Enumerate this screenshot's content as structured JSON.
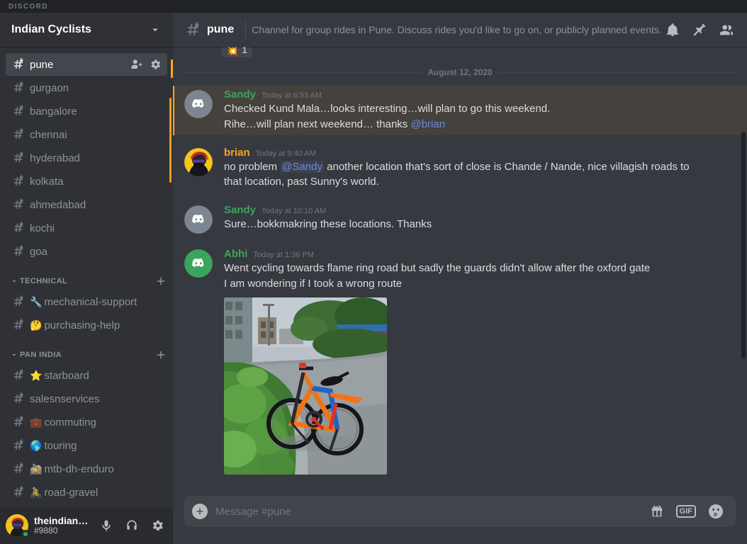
{
  "titlebar": {
    "wordmark": "DISCORD"
  },
  "sidebar": {
    "server_name": "Indian Cyclists",
    "chevron_icon": "chevron-down-icon",
    "channels": [
      {
        "name": "pune",
        "emoji": "",
        "active": true,
        "locked": true,
        "actions": [
          "add-member-icon",
          "gear-icon"
        ]
      },
      {
        "name": "gurgaon",
        "emoji": "",
        "active": false,
        "locked": true
      },
      {
        "name": "bangalore",
        "emoji": "",
        "active": false,
        "locked": true
      },
      {
        "name": "chennai",
        "emoji": "",
        "active": false,
        "locked": true
      },
      {
        "name": "hyderabad",
        "emoji": "",
        "active": false,
        "locked": true
      },
      {
        "name": "kolkata",
        "emoji": "",
        "active": false,
        "locked": true
      },
      {
        "name": "ahmedabad",
        "emoji": "",
        "active": false,
        "locked": true
      },
      {
        "name": "kochi",
        "emoji": "",
        "active": false,
        "locked": true
      },
      {
        "name": "goa",
        "emoji": "",
        "active": false,
        "locked": true
      }
    ],
    "categories": [
      {
        "name": "TECHNICAL",
        "add_icon": "plus-icon",
        "channels": [
          {
            "name": "mechanical-support",
            "emoji": "🔧",
            "locked": true
          },
          {
            "name": "purchasing-help",
            "emoji": "🤔",
            "locked": true
          }
        ]
      },
      {
        "name": "PAN INDIA",
        "add_icon": "plus-icon",
        "channels": [
          {
            "name": "starboard",
            "emoji": "⭐",
            "locked": true
          },
          {
            "name": "salesnservices",
            "emoji": "",
            "locked": true
          },
          {
            "name": "commuting",
            "emoji": "💼",
            "locked": true
          },
          {
            "name": "touring",
            "emoji": "🌎",
            "locked": true
          },
          {
            "name": "mtb-dh-enduro",
            "emoji": "🚵",
            "locked": true
          },
          {
            "name": "road-gravel",
            "emoji": "🚴",
            "locked": true
          }
        ]
      }
    ],
    "user_panel": {
      "username": "theindiancy...",
      "discriminator": "#9880",
      "status": "online",
      "buttons": [
        {
          "name": "microphone-icon",
          "label": "Mute"
        },
        {
          "name": "headphones-icon",
          "label": "Deafen"
        },
        {
          "name": "gear-icon",
          "label": "User Settings"
        }
      ]
    },
    "colors": {
      "accent_orange": "#faa61a",
      "background": "#2f3136"
    }
  },
  "header": {
    "hash_icon": "hash-lock-icon",
    "channel_name": "pune",
    "topic": "Channel for group rides in Pune. Discuss rides you'd like to go on, or publicly planned events.",
    "icons": [
      {
        "name": "bell-icon",
        "label": "Notification Settings"
      },
      {
        "name": "pin-icon",
        "label": "Pinned Messages"
      },
      {
        "name": "members-icon",
        "label": "Member List"
      }
    ]
  },
  "messages": {
    "top_reaction": {
      "emoji": "💥",
      "count": "1"
    },
    "date_divider": "August 12, 2020",
    "items": [
      {
        "author": "Sandy",
        "author_color": "#3ba55d",
        "timestamp": "Today at 6:53 AM",
        "avatar": "discord-default-grey",
        "mention_highlight": true,
        "lines": [
          [
            {
              "t": "Checked Kund Mala…looks interesting…will plan to go this weekend.",
              "k": "plain"
            }
          ],
          [
            {
              "t": "Rihe…will plan next weekend… thanks ",
              "k": "plain"
            },
            {
              "t": "@brian",
              "k": "mention"
            }
          ]
        ]
      },
      {
        "author": "brian",
        "author_color": "#faa61a",
        "timestamp": "Today at 9:40 AM",
        "avatar": "cyclist-yellow",
        "mention_highlight": false,
        "lines": [
          [
            {
              "t": "no problem ",
              "k": "plain"
            },
            {
              "t": "@Sandy",
              "k": "mention-pill"
            },
            {
              "t": " another location that's sort of close is Chande / Nande, nice villagish roads to",
              "k": "plain"
            }
          ],
          [
            {
              "t": "that location, past Sunny's world.",
              "k": "plain"
            }
          ]
        ]
      },
      {
        "author": "Sandy",
        "author_color": "#3ba55d",
        "timestamp": "Today at 10:10 AM",
        "avatar": "discord-default-grey",
        "mention_highlight": false,
        "lines": [
          [
            {
              "t": "Sure…bokkmakring these locations. Thanks",
              "k": "plain"
            }
          ]
        ]
      },
      {
        "author": "Abhi",
        "author_color": "#3ba55d",
        "timestamp": "Today at 1:36 PM",
        "avatar": "discord-default-green",
        "mention_highlight": false,
        "lines": [
          [
            {
              "t": "Went cycling towards flame ring road but sadly the guards didn't allow after the oxford gate",
              "k": "plain"
            }
          ],
          [
            {
              "t": "I am wondering if I took a wrong route",
              "k": "plain"
            }
          ]
        ],
        "image": "bicycle-on-road-photo"
      }
    ]
  },
  "composer": {
    "add_icon": "plus-icon",
    "placeholder": "Message #pune",
    "icons": [
      {
        "name": "gift-icon",
        "label": "Gift"
      },
      {
        "name": "gif-icon",
        "label": "GIF"
      },
      {
        "name": "emoji-icon",
        "label": "Emoji"
      }
    ]
  }
}
